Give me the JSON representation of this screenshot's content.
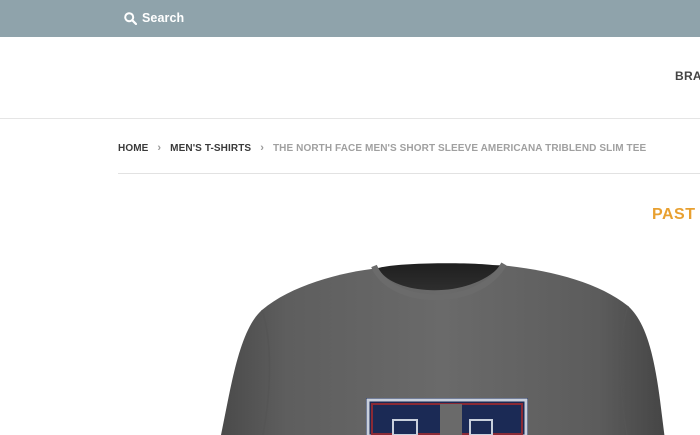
{
  "topbar": {
    "search_label": "Search",
    "search_icon": "search-icon",
    "background": "#8fa3ab"
  },
  "header": {
    "nav_item": "BRA"
  },
  "breadcrumb": {
    "items": [
      "HOME",
      "MEN'S T-SHIRTS",
      "THE NORTH FACE MEN'S SHORT SLEEVE AMERICANA TRIBLEND SLIM TEE"
    ],
    "separator": "›"
  },
  "promo": {
    "label": "PAST",
    "color": "#e8a030"
  },
  "product": {
    "image": "gray-tshirt-with-varsity-letter-graphic"
  }
}
